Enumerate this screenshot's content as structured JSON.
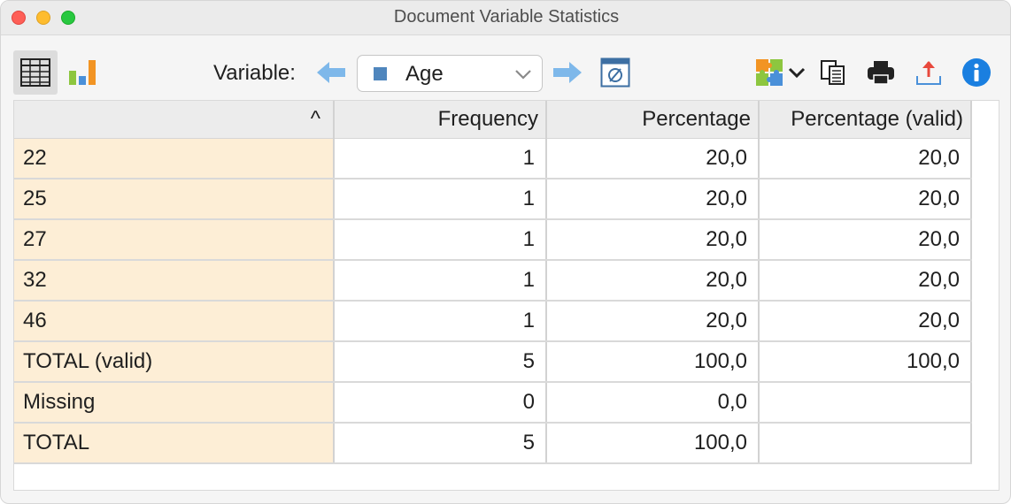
{
  "window": {
    "title": "Document Variable Statistics"
  },
  "toolbar": {
    "variable_label": "Variable:",
    "variable_value": "Age",
    "icons": [
      "table-view-icon",
      "chart-view-icon",
      "previous-arrow-icon",
      "next-arrow-icon",
      "exclude-missing-icon",
      "color-scheme-icon",
      "dropdown-chevron-icon",
      "copy-icon",
      "print-icon",
      "export-icon",
      "info-icon"
    ]
  },
  "table": {
    "sort_indicator": "^",
    "columns": [
      "",
      "Frequency",
      "Percentage",
      "Percentage (valid)"
    ],
    "rows": [
      {
        "label": "22",
        "frequency": "1",
        "percentage": "20,0",
        "valid": "20,0"
      },
      {
        "label": "25",
        "frequency": "1",
        "percentage": "20,0",
        "valid": "20,0"
      },
      {
        "label": "27",
        "frequency": "1",
        "percentage": "20,0",
        "valid": "20,0"
      },
      {
        "label": "32",
        "frequency": "1",
        "percentage": "20,0",
        "valid": "20,0"
      },
      {
        "label": "46",
        "frequency": "1",
        "percentage": "20,0",
        "valid": "20,0"
      },
      {
        "label": "TOTAL (valid)",
        "frequency": "5",
        "percentage": "100,0",
        "valid": "100,0"
      },
      {
        "label": "Missing",
        "frequency": "0",
        "percentage": "0,0",
        "valid": ""
      },
      {
        "label": "TOTAL",
        "frequency": "5",
        "percentage": "100,0",
        "valid": ""
      }
    ]
  },
  "colors": {
    "label_column": "#fdeed6",
    "accent_blue": "#1a7fe0",
    "arrow_blue": "#7eb8ea"
  }
}
